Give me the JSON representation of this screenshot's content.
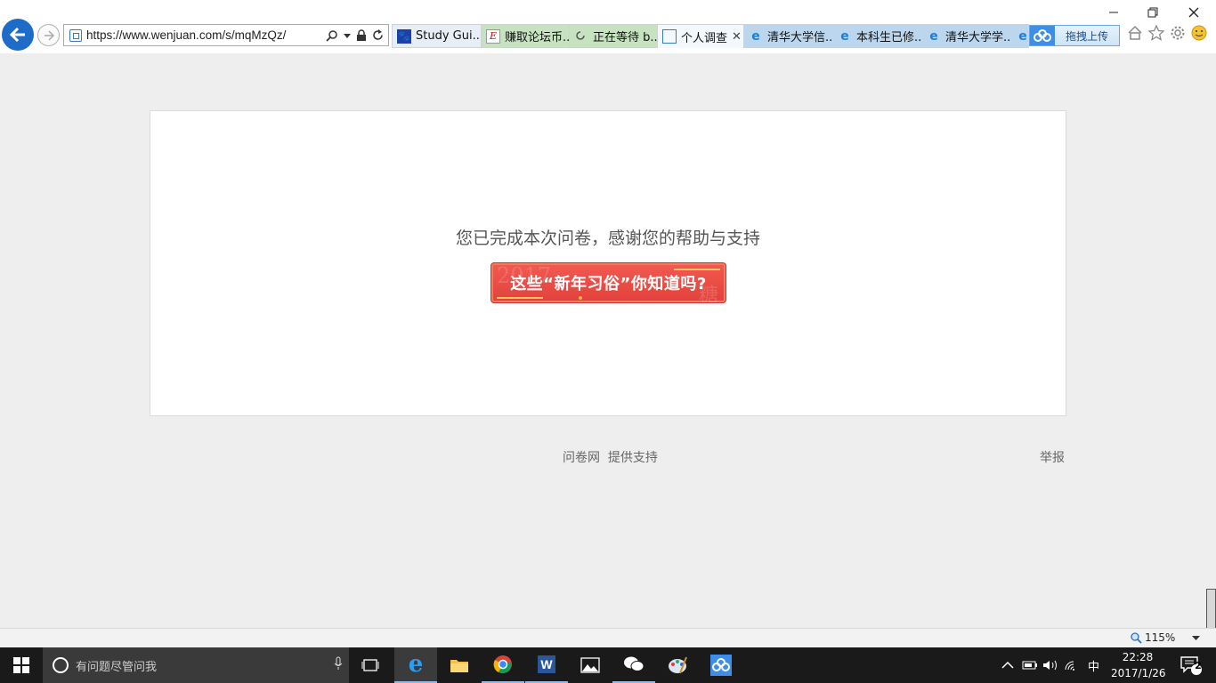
{
  "browser": {
    "url": "https://www.wenjuan.com/s/mqMzQz/",
    "url_domain_part": "https://www.wenjuan.com",
    "url_path_part": "/s/mqMzQz/",
    "tabs": [
      {
        "label": "Study Gui...",
        "icon": "paw-icon",
        "active": false,
        "bg": "#e7eef6"
      },
      {
        "label": "赚取论坛币...",
        "icon": "e-forum-icon",
        "active": false,
        "bg": "#c6e2c0"
      },
      {
        "label": "正在等待 b...",
        "icon": "loading-icon",
        "active": false,
        "bg": "#c6e2c0"
      },
      {
        "label": "个人调查",
        "icon": "site-icon",
        "active": true,
        "bg": "#f3f8fd"
      },
      {
        "label": "清华大学信...",
        "icon": "ie-icon",
        "active": false,
        "bg": "#bcd6ee"
      },
      {
        "label": "本科生已修...",
        "icon": "ie-icon",
        "active": false,
        "bg": "#bcd6ee"
      },
      {
        "label": "清华大学学...",
        "icon": "ie-icon",
        "active": false,
        "bg": "#bcd6ee"
      }
    ],
    "upload_button": "拖拽上传",
    "zoom": "115%"
  },
  "page": {
    "done_message": "您已完成本次问卷，感谢您的帮助与支持",
    "promo_button": "这些“新年习俗”你知道吗?",
    "promo_watermark_left": "2017",
    "promo_watermark_right": "糖",
    "footer_support": "问卷网  提供支持",
    "footer_report": "举报"
  },
  "taskbar": {
    "search_placeholder": "有问题尽管问我",
    "ime": "中",
    "time": "22:28",
    "date": "2017/1/26",
    "notification_count": "2"
  },
  "colors": {
    "ie_blue": "#1e6cc8",
    "promo_red": "#e8463f",
    "page_bg": "#eeeeee",
    "taskbar": "#1a1a1a"
  }
}
